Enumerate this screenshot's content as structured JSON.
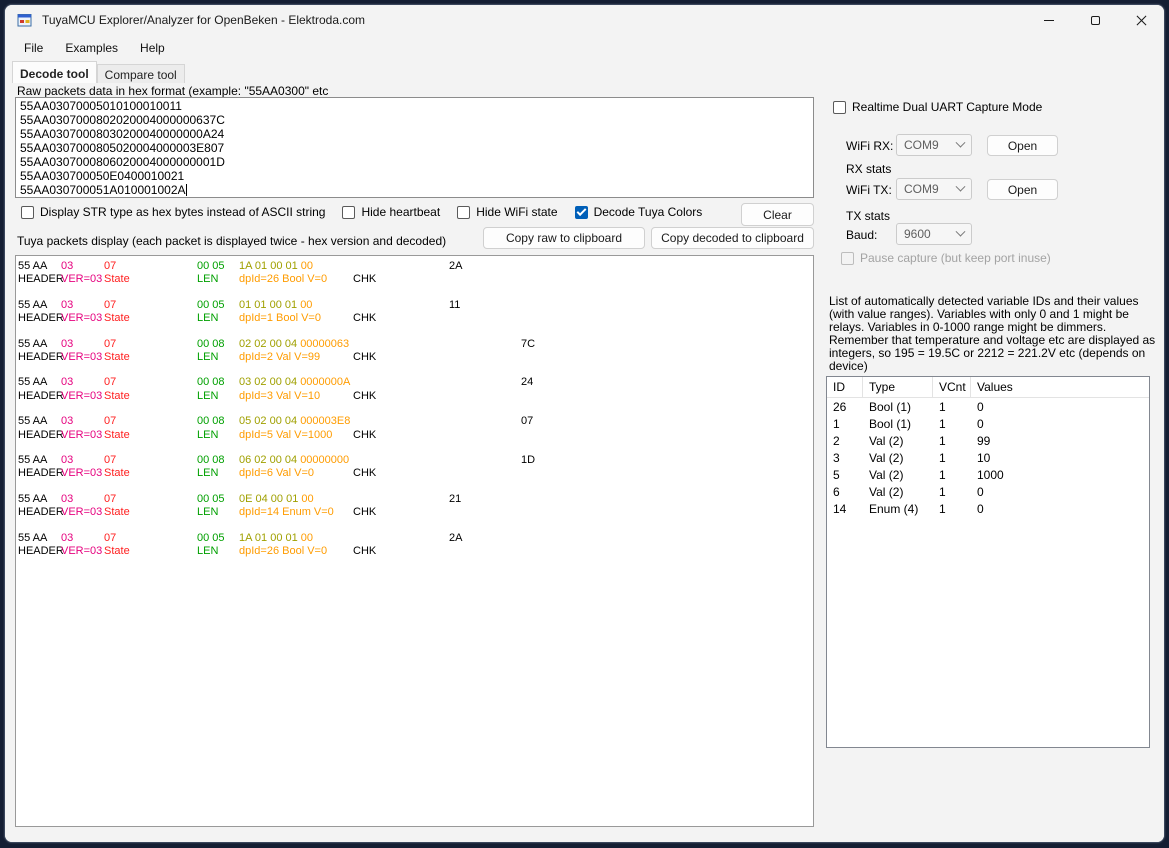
{
  "colors": {
    "accent": "#005fb8",
    "ver": "#e6007e",
    "state": "#ff2020",
    "len": "#00a000",
    "data": "#a0a000",
    "value": "#ff9c00"
  },
  "window": {
    "title": "TuyaMCU Explorer/Analyzer for OpenBeken - Elektroda.com"
  },
  "menu": [
    "File",
    "Examples",
    "Help"
  ],
  "tabs": [
    {
      "label": "Decode tool"
    },
    {
      "label": "Compare tool"
    }
  ],
  "raw_section": {
    "label": "Raw packets data in hex format (example: \"55AA0300\" etc",
    "lines": [
      "55AA03070005010100010011",
      "55AA0307000802020004000000637C",
      "55AA03070008030200040000000A24",
      "55AA0307000805020004000003E807",
      "55AA0307000806020004000000001D",
      "55AA030700050E0400010021",
      "55AA030700051A010001002A"
    ]
  },
  "options": {
    "checkboxes": [
      {
        "label": "Display STR type as hex bytes instead of ASCII string",
        "checked": false
      },
      {
        "label": "Hide heartbeat",
        "checked": false
      },
      {
        "label": "Hide WiFi state",
        "checked": false
      },
      {
        "label": "Decode Tuya Colors",
        "checked": true
      }
    ],
    "clear_button": "Clear"
  },
  "packets_section": {
    "label": "Tuya packets display (each packet is displayed twice - hex version and decoded)",
    "copy_raw_button": "Copy raw to clipboard",
    "copy_decoded_button": "Copy decoded to clipboard",
    "row_labels": {
      "header": "HEADER",
      "ver": "VER=03",
      "cmd": "State",
      "len": "LEN",
      "chk": "CHK"
    },
    "packets": [
      {
        "header": "55 AA",
        "ver": "03",
        "cmd": "07",
        "len": "00 05",
        "data": "1A 01 00 01",
        "value": "00",
        "chk": "2A",
        "decoded": "dpId=26 Bool V=0",
        "wide": false
      },
      {
        "header": "55 AA",
        "ver": "03",
        "cmd": "07",
        "len": "00 05",
        "data": "01 01 00 01",
        "value": "00",
        "chk": "11",
        "decoded": "dpId=1 Bool V=0",
        "wide": false
      },
      {
        "header": "55 AA",
        "ver": "03",
        "cmd": "07",
        "len": "00 08",
        "data": "02 02 00 04",
        "value": "00000063",
        "chk": "7C",
        "decoded": "dpId=2 Val V=99",
        "wide": true
      },
      {
        "header": "55 AA",
        "ver": "03",
        "cmd": "07",
        "len": "00 08",
        "data": "03 02 00 04",
        "value": "0000000A",
        "chk": "24",
        "decoded": "dpId=3 Val V=10",
        "wide": true
      },
      {
        "header": "55 AA",
        "ver": "03",
        "cmd": "07",
        "len": "00 08",
        "data": "05 02 00 04",
        "value": "000003E8",
        "chk": "07",
        "decoded": "dpId=5 Val V=1000",
        "wide": true
      },
      {
        "header": "55 AA",
        "ver": "03",
        "cmd": "07",
        "len": "00 08",
        "data": "06 02 00 04",
        "value": "00000000",
        "chk": "1D",
        "decoded": "dpId=6 Val V=0",
        "wide": true
      },
      {
        "header": "55 AA",
        "ver": "03",
        "cmd": "07",
        "len": "00 05",
        "data": "0E 04 00 01",
        "value": "00",
        "chk": "21",
        "decoded": "dpId=14 Enum V=0",
        "wide": false
      },
      {
        "header": "55 AA",
        "ver": "03",
        "cmd": "07",
        "len": "00 05",
        "data": "1A 01 00 01",
        "value": "00",
        "chk": "2A",
        "decoded": "dpId=26 Bool V=0",
        "wide": false
      }
    ]
  },
  "capture_panel": {
    "realtime_checkbox": "Realtime Dual UART Capture Mode",
    "wifi_rx_label": "WiFi RX:",
    "rx_stats_label": "RX stats",
    "wifi_tx_label": "WiFi TX:",
    "tx_stats_label": "TX stats",
    "baud_label": "Baud:",
    "com_port": "COM9",
    "baud_value": "9600",
    "open_button": "Open",
    "pause_checkbox": "Pause capture (but keep port inuse)"
  },
  "variables_panel": {
    "description": "List of automatically detected variable IDs  and their values (with value ranges). Variables with only 0 and 1 might be relays. Variables in 0-1000 range might be dimmers. Remember that temperature and voltage etc are displayed as integers, so 195 = 19.5C or 2212 = 221.2V etc (depends on device)",
    "table": {
      "headers": [
        "ID",
        "Type",
        "VCnt",
        "Values"
      ],
      "rows": [
        [
          "26",
          "Bool (1)",
          "1",
          "0"
        ],
        [
          "1",
          "Bool (1)",
          "1",
          "0"
        ],
        [
          "2",
          "Val (2)",
          "1",
          "99"
        ],
        [
          "3",
          "Val (2)",
          "1",
          "10"
        ],
        [
          "5",
          "Val (2)",
          "1",
          "1000"
        ],
        [
          "6",
          "Val (2)",
          "1",
          "0"
        ],
        [
          "14",
          "Enum (4)",
          "1",
          "0"
        ]
      ]
    }
  }
}
